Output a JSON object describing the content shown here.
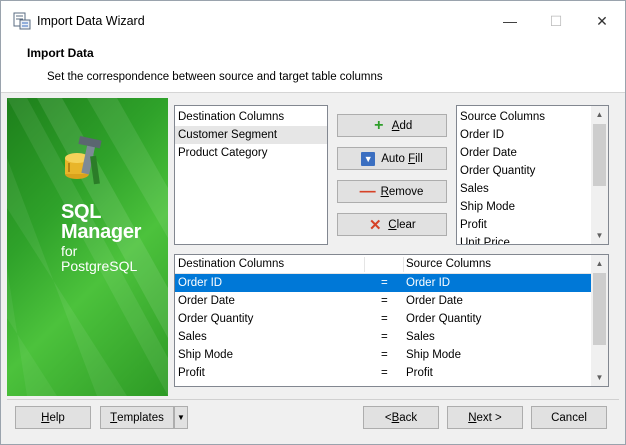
{
  "window": {
    "title": "Import Data Wizard",
    "minimize_glyph": "—",
    "maximize_glyph": "☐",
    "close_glyph": "✕"
  },
  "header": {
    "title": "Import Data",
    "subtitle": "Set the correspondence between source and target table columns"
  },
  "banner": {
    "line1": "SQL",
    "line2": "Manager",
    "line3": "for",
    "line4": "PostgreSQL",
    "icon": "tools-icon"
  },
  "destination_list": {
    "header": "Destination Columns",
    "items": [
      "Customer Segment",
      "Product Category"
    ],
    "selected_index": 0
  },
  "source_list": {
    "header": "Source Columns",
    "items": [
      "Order ID",
      "Order Date",
      "Order Quantity",
      "Sales",
      "Ship Mode",
      "Profit",
      "Unit Price"
    ]
  },
  "actions": {
    "add": {
      "label_u": "A",
      "label_rest": "dd",
      "icon": "plus-icon"
    },
    "auto_fill": {
      "label_pre": "Auto ",
      "label_u": "F",
      "label_rest": "ill",
      "icon": "auto-fill-icon"
    },
    "remove": {
      "label_u": "R",
      "label_rest": "emove",
      "icon": "minus-icon"
    },
    "clear": {
      "label_u": "C",
      "label_rest": "lear",
      "icon": "x-icon"
    }
  },
  "mapping": {
    "col_dest": "Destination Columns",
    "col_src": "Source Columns",
    "rows": [
      {
        "dest": "Order ID",
        "eq": "=",
        "src": "Order ID"
      },
      {
        "dest": "Order Date",
        "eq": "=",
        "src": "Order Date"
      },
      {
        "dest": "Order Quantity",
        "eq": "=",
        "src": "Order Quantity"
      },
      {
        "dest": "Sales",
        "eq": "=",
        "src": "Sales"
      },
      {
        "dest": "Ship Mode",
        "eq": "=",
        "src": "Ship Mode"
      },
      {
        "dest": "Profit",
        "eq": "=",
        "src": "Profit"
      }
    ],
    "selected_index": 0
  },
  "footer": {
    "help": {
      "u": "H",
      "rest": "elp"
    },
    "templates": {
      "u": "T",
      "rest": "emplates"
    },
    "back": {
      "pre": "< ",
      "u": "B",
      "rest": "ack"
    },
    "next": {
      "u": "N",
      "rest": "ext >"
    },
    "cancel": "Cancel"
  },
  "colors": {
    "selection": "#0078d7",
    "banner_green": "#2fa22a",
    "add_icon": "#2e9e2a",
    "remove_icon": "#d64227"
  }
}
